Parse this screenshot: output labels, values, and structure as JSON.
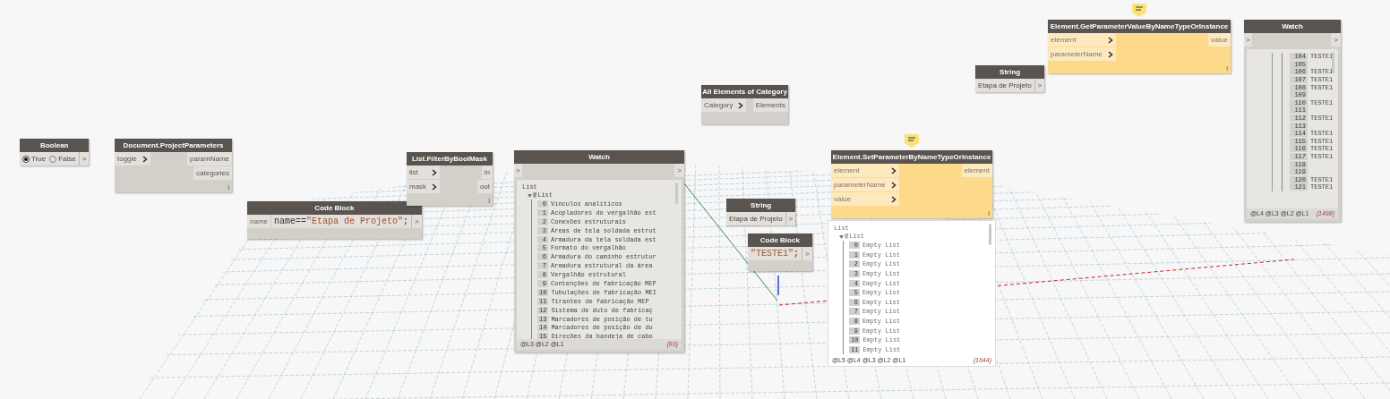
{
  "nodes": [
    {
      "kind": "boolean",
      "title": "Boolean",
      "selected": false,
      "options": [
        {
          "label": "True",
          "selected": true
        },
        {
          "label": "False",
          "selected": false
        }
      ],
      "outputs": [
        ">"
      ]
    },
    {
      "kind": "function",
      "title": "Document.ProjectParameters",
      "selected": false,
      "inputs": [
        "toggle"
      ],
      "outputs": [
        "paramName",
        "categories"
      ],
      "lacing": "l"
    },
    {
      "kind": "code_block",
      "title": "Code Block",
      "selected": false,
      "inputs": [
        "name"
      ],
      "code": [
        {
          "kind": "plain",
          "text": "name=="
        },
        {
          "kind": "string",
          "text": "\"Etapa de Projeto\""
        },
        {
          "kind": "plain",
          "text": ";"
        }
      ],
      "outputs": [
        ">"
      ]
    },
    {
      "kind": "function",
      "title": "List.FilterByBoolMask",
      "selected": false,
      "inputs": [
        "list",
        "mask"
      ],
      "outputs": [
        "in",
        "out"
      ],
      "lacing": "l"
    },
    {
      "kind": "watch",
      "title": "Watch",
      "selected": false,
      "inputs": [
        ">"
      ],
      "outputs": [
        ">"
      ],
      "preview": {
        "root": "List",
        "branch": "List",
        "branch_marker": "@",
        "items": [
          {
            "index": "0",
            "text": "Vínculos analíticos"
          },
          {
            "index": "1",
            "text": "Acopladores do vergalhão est"
          },
          {
            "index": "2",
            "text": "Conexões estruturais"
          },
          {
            "index": "3",
            "text": "Áreas de tela soldada estrut"
          },
          {
            "index": "4",
            "text": "Armadura da tela soldada est"
          },
          {
            "index": "5",
            "text": "Formato do vergalhão"
          },
          {
            "index": "6",
            "text": "Armadura do caminho estrutur"
          },
          {
            "index": "7",
            "text": "Armadura estrutural da área"
          },
          {
            "index": "8",
            "text": "Vergalhão estrutural"
          },
          {
            "index": "9",
            "text": "Contenções de fabricação MEP"
          },
          {
            "index": "10",
            "text": "Tubulações de fabricação MEI"
          },
          {
            "index": "11",
            "text": "Tirantes de fabricação MEP"
          },
          {
            "index": "12",
            "text": "Sistema de duto de fabricaç"
          },
          {
            "index": "13",
            "text": "Marcadores de posição de tu"
          },
          {
            "index": "14",
            "text": "Marcadores de posição de du"
          },
          {
            "index": "15",
            "text": "Direções da bandeja de cabo"
          }
        ],
        "levels": "@L3 @L2 @L1",
        "count": "{83}"
      }
    },
    {
      "kind": "function",
      "title": "All Elements of Category",
      "selected": false,
      "inputs": [
        "Category"
      ],
      "outputs": [
        "Elements"
      ]
    },
    {
      "kind": "string",
      "title": "String",
      "selected": false,
      "value": "Etapa de Projeto",
      "outputs": [
        ">"
      ]
    },
    {
      "kind": "code_block",
      "title": "Code Block",
      "selected": false,
      "code": [
        {
          "kind": "string",
          "text": "\"TESTE1\""
        },
        {
          "kind": "plain",
          "text": ";"
        }
      ],
      "outputs": [
        ">"
      ]
    },
    {
      "kind": "function",
      "title": "Element.SetParameterByNameTypeOrInstance",
      "selected": true,
      "info_marker": true,
      "inputs": [
        "element",
        "parameterName",
        "value"
      ],
      "outputs": [
        "element"
      ],
      "lacing": "l",
      "preview": {
        "root": "List",
        "branch": "List",
        "branch_marker": "@",
        "items": [
          {
            "index": "0",
            "text": "Empty List"
          },
          {
            "index": "1",
            "text": "Empty List"
          },
          {
            "index": "2",
            "text": "Empty List"
          },
          {
            "index": "3",
            "text": "Empty List"
          },
          {
            "index": "4",
            "text": "Empty List"
          },
          {
            "index": "5",
            "text": "Empty List"
          },
          {
            "index": "6",
            "text": "Empty List"
          },
          {
            "index": "7",
            "text": "Empty List"
          },
          {
            "index": "8",
            "text": "Empty List"
          },
          {
            "index": "9",
            "text": "Empty List"
          },
          {
            "index": "10",
            "text": "Empty List"
          },
          {
            "index": "11",
            "text": "Empty List"
          }
        ],
        "levels": "@L5 @L4 @L3 @L2 @L1",
        "count": "{1644}"
      }
    },
    {
      "kind": "string",
      "title": "String",
      "selected": false,
      "value": "Etapa de Projeto",
      "outputs": [
        ">"
      ]
    },
    {
      "kind": "function",
      "title": "Element.GetParameterValueByNameTypeOrInstance",
      "selected": true,
      "info_marker": true,
      "inputs": [
        "element",
        "parameterName"
      ],
      "outputs": [
        "value"
      ],
      "lacing": "l"
    },
    {
      "kind": "watch",
      "title": "Watch",
      "selected": false,
      "inputs": [
        ">"
      ],
      "outputs": [
        ">"
      ],
      "preview": {
        "items": [
          {
            "index": "104",
            "text": "TESTE1"
          },
          {
            "index": "105"
          },
          {
            "index": "106",
            "text": "TESTE1"
          },
          {
            "index": "107",
            "text": "TESTE1"
          },
          {
            "index": "108",
            "text": "TESTE1"
          },
          {
            "index": "109"
          },
          {
            "index": "110",
            "text": "TESTE1"
          },
          {
            "index": "111"
          },
          {
            "index": "112",
            "text": "TESTE1"
          },
          {
            "index": "113"
          },
          {
            "index": "114",
            "text": "TESTE1"
          },
          {
            "index": "115",
            "text": "TESTE1"
          },
          {
            "index": "116",
            "text": "TESTE1"
          },
          {
            "index": "117",
            "text": "TESTE1"
          },
          {
            "index": "118"
          },
          {
            "index": "119"
          },
          {
            "index": "120",
            "text": "TESTE1"
          },
          {
            "index": "121",
            "text": "TESTE1"
          }
        ],
        "levels": "@L4 @L3 @L2 @L1",
        "count": "{1498}"
      }
    }
  ]
}
